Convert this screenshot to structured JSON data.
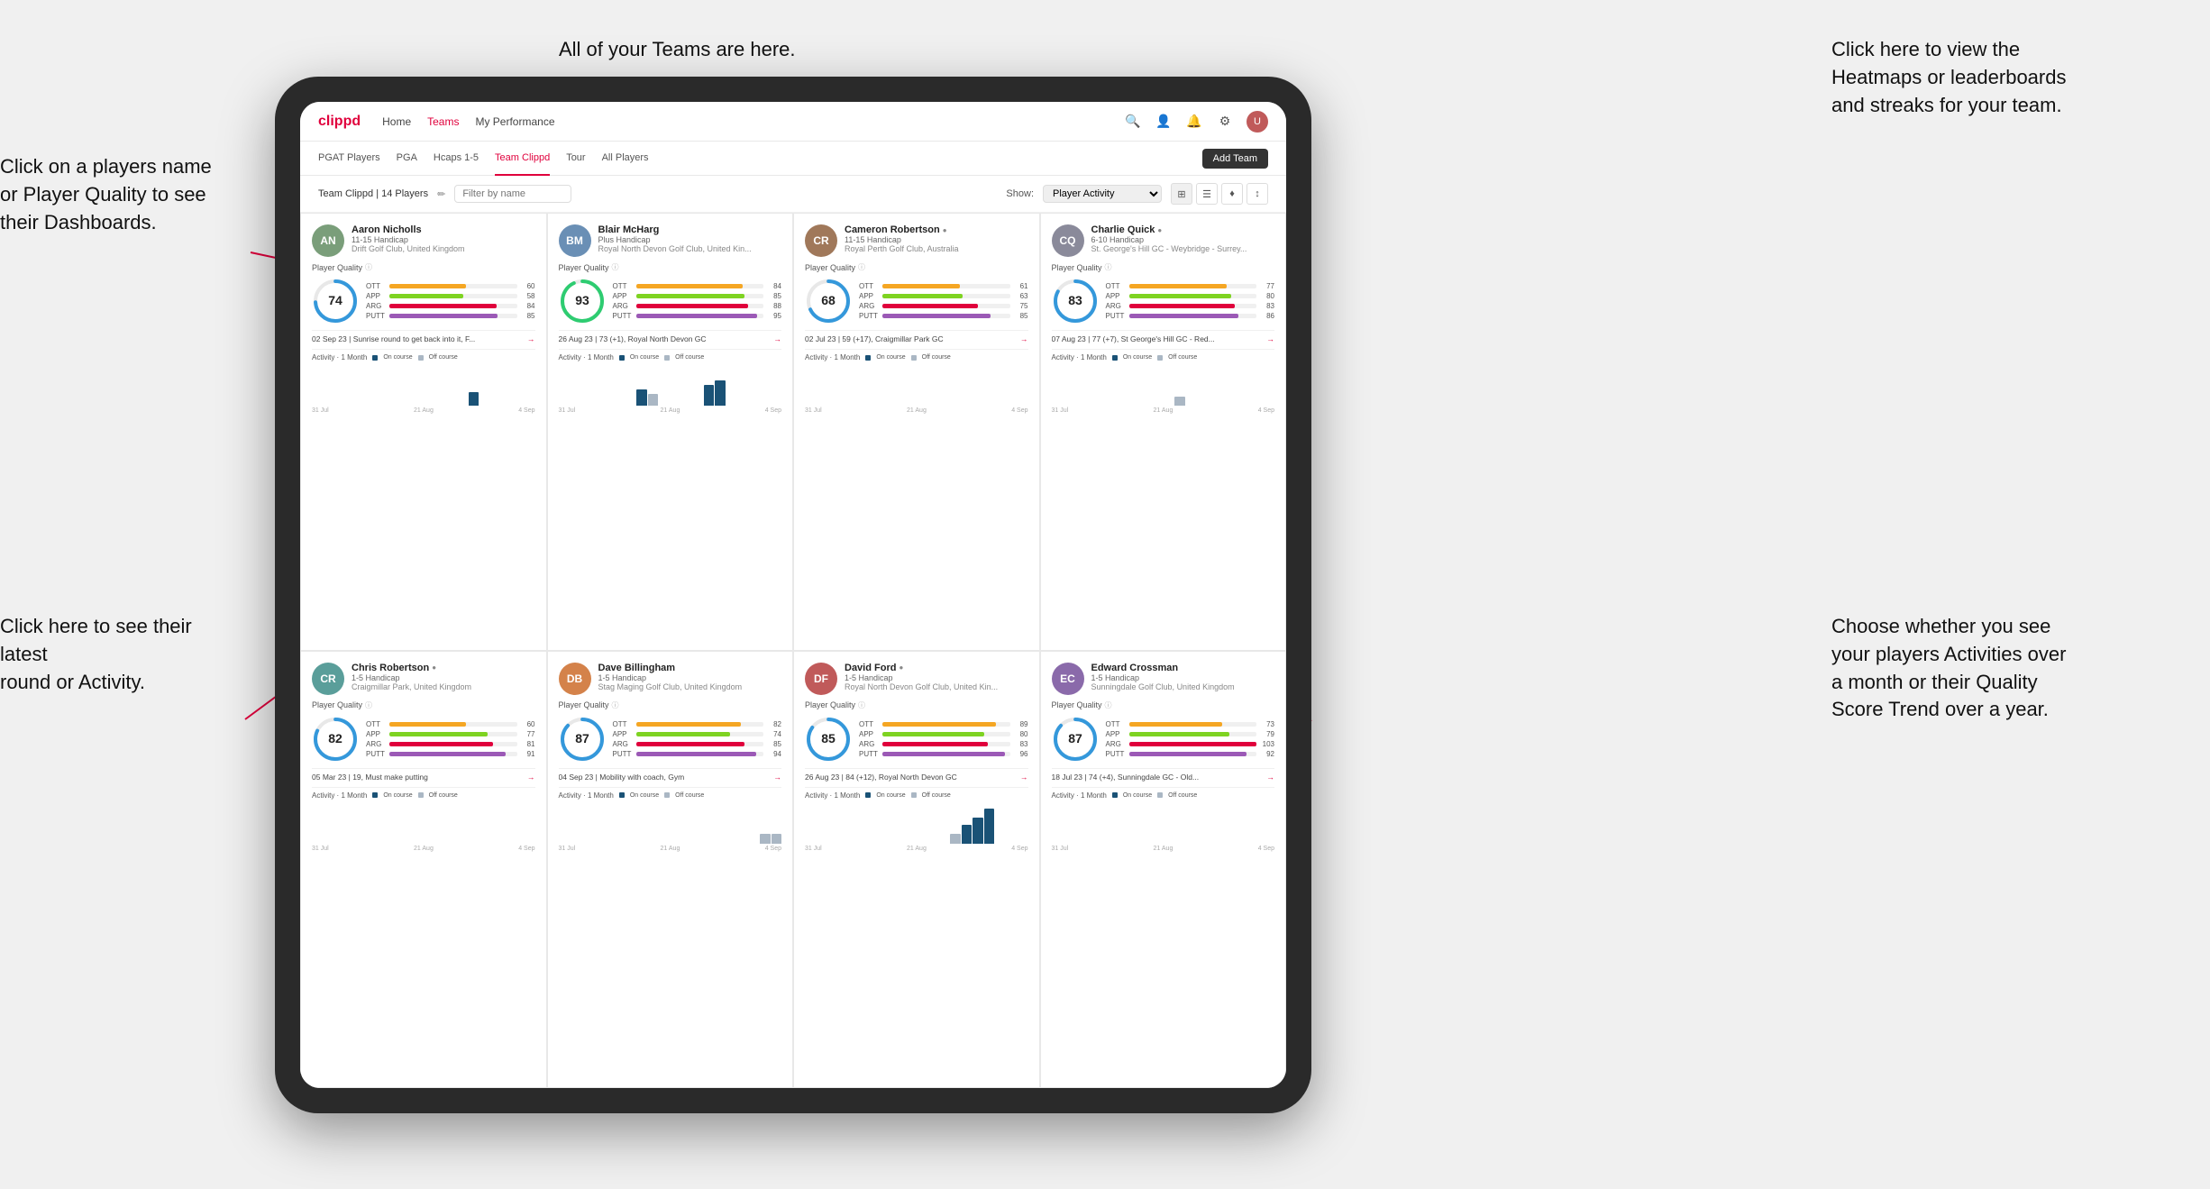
{
  "annotations": {
    "top_center": "All of your Teams are here.",
    "top_right": "Click here to view the\nHeatmaps or leaderboards\nand streaks for your team.",
    "left_1": "Click on a players name\nor Player Quality to see\ntheir Dashboards.",
    "left_2": "Click here to see their latest\nround or Activity.",
    "right_2": "Choose whether you see\nyour players Activities over\na month or their Quality\nScore Trend over a year."
  },
  "nav": {
    "logo": "clippd",
    "links": [
      "Home",
      "Teams",
      "My Performance"
    ],
    "active": "Teams"
  },
  "tabs": {
    "items": [
      "PGAT Players",
      "PGA",
      "Hcaps 1-5",
      "Team Clippd",
      "Tour",
      "All Players"
    ],
    "active": "Team Clippd",
    "add_button": "Add Team"
  },
  "filter_bar": {
    "team_label": "Team Clippd | 14 Players",
    "search_placeholder": "Filter by name",
    "show_label": "Show:",
    "show_value": "Player Activity"
  },
  "players": [
    {
      "name": "Aaron Nicholls",
      "handicap": "11-15 Handicap",
      "club": "Drift Golf Club, United Kingdom",
      "quality": 74,
      "ott": 60,
      "app": 58,
      "arg": 84,
      "putt": 85,
      "latest_round": "02 Sep 23 | Sunrise round to get back into it, F...",
      "avatar_color": "av-green",
      "initials": "AN",
      "bars": [
        {
          "label": "OTT",
          "value": 60,
          "color": "#f5a623"
        },
        {
          "label": "APP",
          "value": 58,
          "color": "#7ed321"
        },
        {
          "label": "ARG",
          "value": 84,
          "color": "#e0003c"
        },
        {
          "label": "PUTT",
          "value": 85,
          "color": "#9b59b6"
        }
      ],
      "chart_bars": [
        0,
        0,
        0,
        0,
        0,
        0,
        0,
        0,
        0,
        0,
        0,
        0,
        0,
        0,
        12,
        0,
        0,
        0,
        0,
        0
      ],
      "dates": [
        "31 Jul",
        "21 Aug",
        "4 Sep"
      ]
    },
    {
      "name": "Blair McHarg",
      "handicap": "Plus Handicap",
      "club": "Royal North Devon Golf Club, United Kin...",
      "quality": 93,
      "ott": 84,
      "app": 85,
      "arg": 88,
      "putt": 95,
      "latest_round": "26 Aug 23 | 73 (+1), Royal North Devon GC",
      "avatar_color": "av-blue",
      "initials": "BM",
      "bars": [
        {
          "label": "OTT",
          "value": 84,
          "color": "#f5a623"
        },
        {
          "label": "APP",
          "value": 85,
          "color": "#7ed321"
        },
        {
          "label": "ARG",
          "value": 88,
          "color": "#e0003c"
        },
        {
          "label": "PUTT",
          "value": 95,
          "color": "#9b59b6"
        }
      ],
      "chart_bars": [
        0,
        0,
        0,
        0,
        0,
        0,
        0,
        14,
        10,
        0,
        0,
        0,
        0,
        18,
        22,
        0,
        0,
        0,
        0,
        0
      ],
      "dates": [
        "31 Jul",
        "21 Aug",
        "4 Sep"
      ]
    },
    {
      "name": "Cameron Robertson",
      "handicap": "11-15 Handicap",
      "club": "Royal Perth Golf Club, Australia",
      "quality": 68,
      "ott": 61,
      "app": 63,
      "arg": 75,
      "putt": 85,
      "latest_round": "02 Jul 23 | 59 (+17), Craigmillar Park GC",
      "avatar_color": "av-brown",
      "initials": "CR",
      "bars": [
        {
          "label": "OTT",
          "value": 61,
          "color": "#f5a623"
        },
        {
          "label": "APP",
          "value": 63,
          "color": "#7ed321"
        },
        {
          "label": "ARG",
          "value": 75,
          "color": "#e0003c"
        },
        {
          "label": "PUTT",
          "value": 85,
          "color": "#9b59b6"
        }
      ],
      "chart_bars": [
        0,
        0,
        0,
        0,
        0,
        0,
        0,
        0,
        0,
        0,
        0,
        0,
        0,
        0,
        0,
        0,
        0,
        0,
        0,
        0
      ],
      "dates": [
        "31 Jul",
        "21 Aug",
        "4 Sep"
      ]
    },
    {
      "name": "Charlie Quick",
      "handicap": "6-10 Handicap",
      "club": "St. George's Hill GC - Weybridge - Surrey...",
      "quality": 83,
      "ott": 77,
      "app": 80,
      "arg": 83,
      "putt": 86,
      "latest_round": "07 Aug 23 | 77 (+7), St George's Hill GC - Red...",
      "avatar_color": "av-gray",
      "initials": "CQ",
      "bars": [
        {
          "label": "OTT",
          "value": 77,
          "color": "#f5a623"
        },
        {
          "label": "APP",
          "value": 80,
          "color": "#7ed321"
        },
        {
          "label": "ARG",
          "value": 83,
          "color": "#e0003c"
        },
        {
          "label": "PUTT",
          "value": 86,
          "color": "#9b59b6"
        }
      ],
      "chart_bars": [
        0,
        0,
        0,
        0,
        0,
        0,
        0,
        0,
        0,
        0,
        0,
        8,
        0,
        0,
        0,
        0,
        0,
        0,
        0,
        0
      ],
      "dates": [
        "31 Jul",
        "21 Aug",
        "4 Sep"
      ]
    },
    {
      "name": "Chris Robertson",
      "handicap": "1-5 Handicap",
      "club": "Craigmillar Park, United Kingdom",
      "quality": 82,
      "ott": 60,
      "app": 77,
      "arg": 81,
      "putt": 91,
      "latest_round": "05 Mar 23 | 19, Must make putting",
      "avatar_color": "av-teal",
      "initials": "CR",
      "bars": [
        {
          "label": "OTT",
          "value": 60,
          "color": "#f5a623"
        },
        {
          "label": "APP",
          "value": 77,
          "color": "#7ed321"
        },
        {
          "label": "ARG",
          "value": 81,
          "color": "#e0003c"
        },
        {
          "label": "PUTT",
          "value": 91,
          "color": "#9b59b6"
        }
      ],
      "chart_bars": [
        0,
        0,
        0,
        0,
        0,
        0,
        0,
        0,
        0,
        0,
        0,
        0,
        0,
        0,
        0,
        0,
        0,
        0,
        0,
        0
      ],
      "dates": [
        "31 Jul",
        "21 Aug",
        "4 Sep"
      ]
    },
    {
      "name": "Dave Billingham",
      "handicap": "1-5 Handicap",
      "club": "Stag Maging Golf Club, United Kingdom",
      "quality": 87,
      "ott": 82,
      "app": 74,
      "arg": 85,
      "putt": 94,
      "latest_round": "04 Sep 23 | Mobility with coach, Gym",
      "avatar_color": "av-orange",
      "initials": "DB",
      "bars": [
        {
          "label": "OTT",
          "value": 82,
          "color": "#f5a623"
        },
        {
          "label": "APP",
          "value": 74,
          "color": "#7ed321"
        },
        {
          "label": "ARG",
          "value": 85,
          "color": "#e0003c"
        },
        {
          "label": "PUTT",
          "value": 94,
          "color": "#9b59b6"
        }
      ],
      "chart_bars": [
        0,
        0,
        0,
        0,
        0,
        0,
        0,
        0,
        0,
        0,
        0,
        0,
        0,
        0,
        0,
        0,
        0,
        0,
        8,
        8
      ],
      "dates": [
        "31 Jul",
        "21 Aug",
        "4 Sep"
      ]
    },
    {
      "name": "David Ford",
      "handicap": "1-5 Handicap",
      "club": "Royal North Devon Golf Club, United Kin...",
      "quality": 85,
      "ott": 89,
      "app": 80,
      "arg": 83,
      "putt": 96,
      "latest_round": "26 Aug 23 | 84 (+12), Royal North Devon GC",
      "avatar_color": "av-red",
      "initials": "DF",
      "bars": [
        {
          "label": "OTT",
          "value": 89,
          "color": "#f5a623"
        },
        {
          "label": "APP",
          "value": 80,
          "color": "#7ed321"
        },
        {
          "label": "ARG",
          "value": 83,
          "color": "#e0003c"
        },
        {
          "label": "PUTT",
          "value": 96,
          "color": "#9b59b6"
        }
      ],
      "chart_bars": [
        0,
        0,
        0,
        0,
        0,
        0,
        0,
        0,
        0,
        0,
        0,
        0,
        0,
        8,
        16,
        22,
        30,
        0,
        0,
        0
      ],
      "dates": [
        "31 Jul",
        "21 Aug",
        "4 Sep"
      ]
    },
    {
      "name": "Edward Crossman",
      "handicap": "1-5 Handicap",
      "club": "Sunningdale Golf Club, United Kingdom",
      "quality": 87,
      "ott": 73,
      "app": 79,
      "arg": 103,
      "putt": 92,
      "latest_round": "18 Jul 23 | 74 (+4), Sunningdale GC - Old...",
      "avatar_color": "av-purple",
      "initials": "EC",
      "bars": [
        {
          "label": "OTT",
          "value": 73,
          "color": "#f5a623"
        },
        {
          "label": "APP",
          "value": 79,
          "color": "#7ed321"
        },
        {
          "label": "ARG",
          "value": 103,
          "color": "#e0003c"
        },
        {
          "label": "PUTT",
          "value": 92,
          "color": "#9b59b6"
        }
      ],
      "chart_bars": [
        0,
        0,
        0,
        0,
        0,
        0,
        0,
        0,
        0,
        0,
        0,
        0,
        0,
        0,
        0,
        0,
        0,
        0,
        0,
        0
      ],
      "dates": [
        "31 Jul",
        "21 Aug",
        "4 Sep"
      ]
    }
  ],
  "activity": {
    "label": "Activity · 1 Month",
    "on_course": "On course",
    "off_course": "Off course"
  }
}
